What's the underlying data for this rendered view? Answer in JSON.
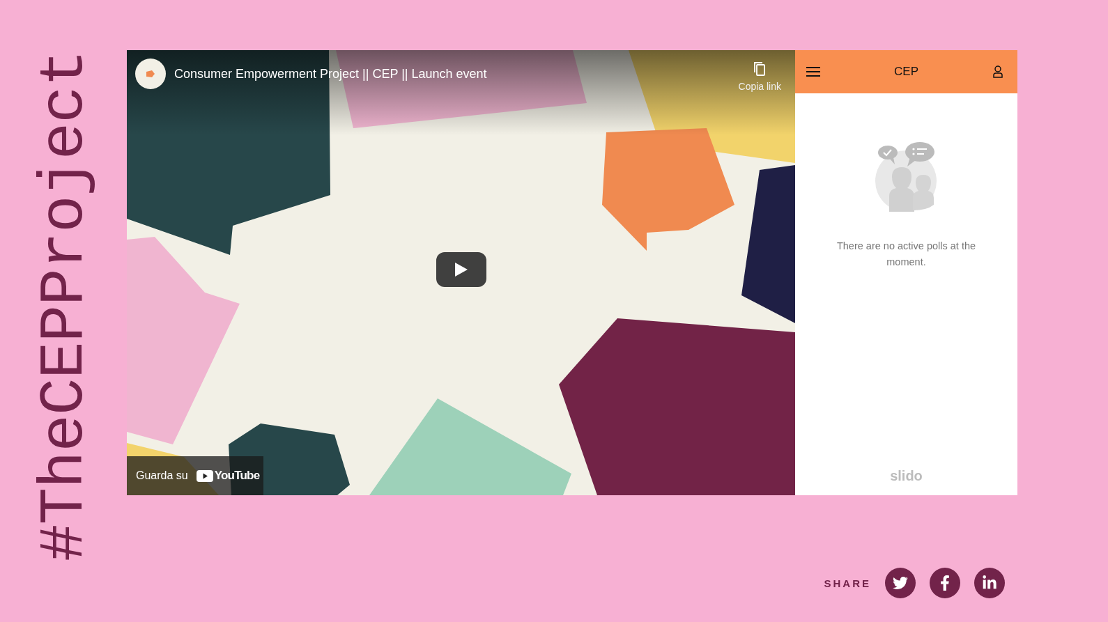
{
  "hashtag": "#TheCEPProject",
  "video": {
    "title": "Consumer Empowerment Project || CEP || Launch event",
    "copy_link": "Copia link",
    "watch_on": "Guarda su",
    "platform": "YouTube"
  },
  "slido": {
    "title": "CEP",
    "empty_message": "There are no active polls at the moment.",
    "brand": "slido"
  },
  "share": {
    "label": "SHARE",
    "networks": [
      {
        "kind": "twitter"
      },
      {
        "kind": "facebook"
      },
      {
        "kind": "linkedin"
      }
    ]
  }
}
